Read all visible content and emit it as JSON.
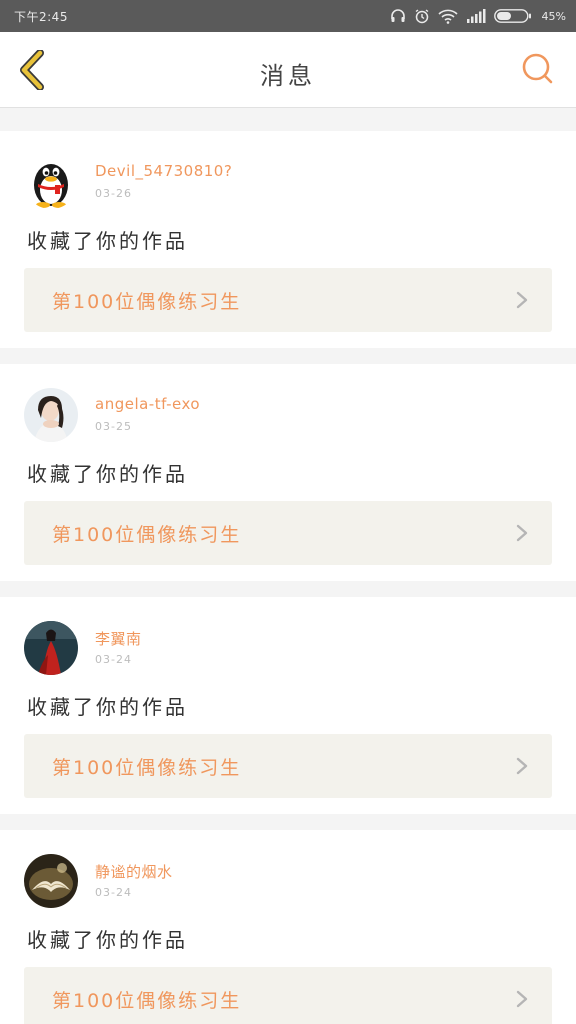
{
  "status_bar": {
    "time": "下午2:45",
    "battery": "45%",
    "icons": [
      "headset-icon",
      "alarm-icon",
      "wifi-icon",
      "signal-icon",
      "battery-icon"
    ]
  },
  "header": {
    "title": "消息",
    "back_icon": "chevron-left-icon",
    "search_icon": "search-icon",
    "accent_color": "#f0975d",
    "back_color": "#e8c23a"
  },
  "messages": [
    {
      "username": "Devil_54730810?",
      "date": "03-26",
      "action": "收藏了你的作品",
      "work": "第100位偶像练习生"
    },
    {
      "username": "angela-tf-exo",
      "date": "03-25",
      "action": "收藏了你的作品",
      "work": "第100位偶像练习生"
    },
    {
      "username": "李翼南",
      "date": "03-24",
      "action": "收藏了你的作品",
      "work": "第100位偶像练习生"
    },
    {
      "username": "静谧的烟水",
      "date": "03-24",
      "action": "收藏了你的作品",
      "work": "第100位偶像练习生"
    }
  ]
}
